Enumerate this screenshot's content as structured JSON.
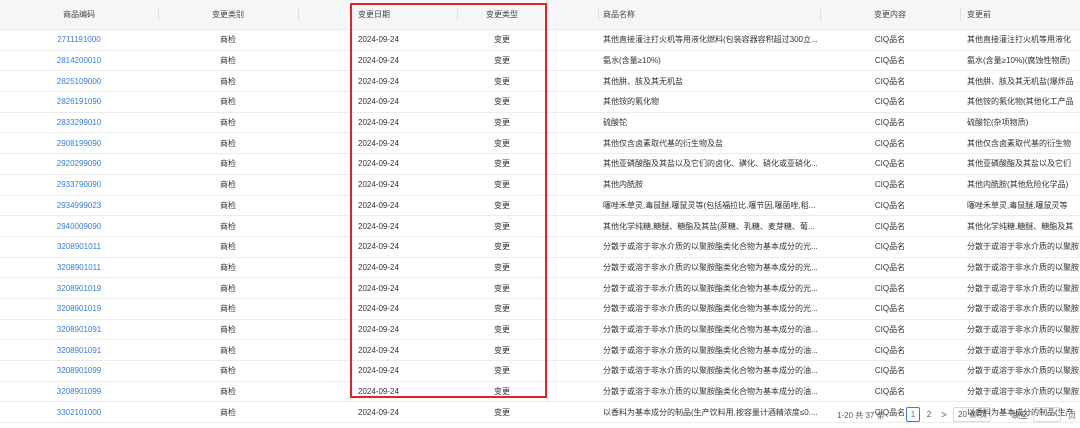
{
  "columns": [
    "商品编码",
    "变更类别",
    "变更日期",
    "变更类型",
    "商品名称",
    "变更内容",
    "变更前"
  ],
  "rows": [
    {
      "code": "2711191000",
      "category": "商检",
      "date": "2024-09-24",
      "type": "变更",
      "name": "其他直接灌注打火机等用液化燃料(包装容器容积超过300立...",
      "content": "CIQ品名",
      "before": "其他直接灌注打火机等用液化"
    },
    {
      "code": "2814200010",
      "category": "商检",
      "date": "2024-09-24",
      "type": "变更",
      "name": "氨水(含量≥10%)",
      "content": "CIQ品名",
      "before": "氨水(含量≥10%)(腐蚀性物质)"
    },
    {
      "code": "2825109000",
      "category": "商检",
      "date": "2024-09-24",
      "type": "变更",
      "name": "其他肼、胲及其无机盐",
      "content": "CIQ品名",
      "before": "其他肼、胲及其无机盐(爆炸品"
    },
    {
      "code": "2826191090",
      "category": "商检",
      "date": "2024-09-24",
      "type": "变更",
      "name": "其他铵的氟化物",
      "content": "CIQ品名",
      "before": "其他铵的氟化物(其他化工产品"
    },
    {
      "code": "2833299010",
      "category": "商检",
      "date": "2024-09-24",
      "type": "变更",
      "name": "硫酸铊",
      "content": "CIQ品名",
      "before": "硫酸铊(杂项物质)"
    },
    {
      "code": "2908199090",
      "category": "商检",
      "date": "2024-09-24",
      "type": "变更",
      "name": "其他仅含卤素取代基的衍生物及盐",
      "content": "CIQ品名",
      "before": "其他仅含卤素取代基的衍生物"
    },
    {
      "code": "2920299090",
      "category": "商检",
      "date": "2024-09-24",
      "type": "变更",
      "name": "其他亚磷酸酯及其盐以及它们的卤化、磺化、硝化或亚硝化...",
      "content": "CIQ品名",
      "before": "其他亚磷酸酯及其盐以及它们"
    },
    {
      "code": "2933790090",
      "category": "商检",
      "date": "2024-09-24",
      "type": "变更",
      "name": "其他内酰胺",
      "content": "CIQ品名",
      "before": "其他内酰胺(其他危险化学品)"
    },
    {
      "code": "2934999023",
      "category": "商检",
      "date": "2024-09-24",
      "type": "变更",
      "name": "噻唑禾草灵,毒鼠醚,噻鼠灵等(包括福拉比,噻节因,噻菌唑,稻...",
      "content": "CIQ品名",
      "before": "噻唑禾草灵,毒鼠醚,噻鼠灵等"
    },
    {
      "code": "2940009090",
      "category": "商检",
      "date": "2024-09-24",
      "type": "变更",
      "name": "其他化学纯糖,糖醚、糖酯及其盐(蔗糖、乳糖、麦芽糖、葡...",
      "content": "CIQ品名",
      "before": "其他化学纯糖,糖醚、糖酯及其"
    },
    {
      "code": "3208901011",
      "category": "商检",
      "date": "2024-09-24",
      "type": "变更",
      "name": "分散于或溶于非水介质的以聚胺酯类化合物为基本成分的光...",
      "content": "CIQ品名",
      "before": "分散于或溶于非水介质的以聚胺"
    },
    {
      "code": "3208901011",
      "category": "商检",
      "date": "2024-09-24",
      "type": "变更",
      "name": "分散于或溶于非水介质的以聚胺酯类化合物为基本成分的光...",
      "content": "CIQ品名",
      "before": "分散于或溶于非水介质的以聚胺"
    },
    {
      "code": "3208901019",
      "category": "商检",
      "date": "2024-09-24",
      "type": "变更",
      "name": "分散于或溶于非水介质的以聚胺酯类化合物为基本成分的光...",
      "content": "CIQ品名",
      "before": "分散于或溶于非水介质的以聚胺"
    },
    {
      "code": "3208901019",
      "category": "商检",
      "date": "2024-09-24",
      "type": "变更",
      "name": "分散于或溶于非水介质的以聚胺酯类化合物为基本成分的光...",
      "content": "CIQ品名",
      "before": "分散于或溶于非水介质的以聚胺"
    },
    {
      "code": "3208901091",
      "category": "商检",
      "date": "2024-09-24",
      "type": "变更",
      "name": "分散于或溶于非水介质的以聚胺酯类化合物为基本成分的油...",
      "content": "CIQ品名",
      "before": "分散于或溶于非水介质的以聚胺"
    },
    {
      "code": "3208901091",
      "category": "商检",
      "date": "2024-09-24",
      "type": "变更",
      "name": "分散于或溶于非水介质的以聚胺酯类化合物为基本成分的油...",
      "content": "CIQ品名",
      "before": "分散于或溶于非水介质的以聚胺"
    },
    {
      "code": "3208901099",
      "category": "商检",
      "date": "2024-09-24",
      "type": "变更",
      "name": "分散于或溶于非水介质的以聚胺酯类化合物为基本成分的油...",
      "content": "CIQ品名",
      "before": "分散于或溶于非水介质的以聚胺"
    },
    {
      "code": "3208901099",
      "category": "商检",
      "date": "2024-09-24",
      "type": "变更",
      "name": "分散于或溶于非水介质的以聚胺酯类化合物为基本成分的油...",
      "content": "CIQ品名",
      "before": "分散于或溶于非水介质的以聚胺"
    },
    {
      "code": "3302101000",
      "category": "商检",
      "date": "2024-09-24",
      "type": "变更",
      "name": "以香料为基本成分的制品(生产饮料用,按容量计酒精浓度≤0....",
      "content": "CIQ品名",
      "before": "以香料为基本成分的制品(生产"
    }
  ],
  "pagination": {
    "total_text": "1-20 共 37 条",
    "prev": "<",
    "pages": [
      "1",
      "2"
    ],
    "next": ">",
    "page_size": "20 条/页",
    "page_size_chevron": "∨",
    "goto_label": "跳至",
    "goto_value": "",
    "page_suffix": "页"
  },
  "colors": {
    "link": "#3a7bd5",
    "highlight_border": "#e0242a",
    "header_bg": "#f5f6f8"
  }
}
